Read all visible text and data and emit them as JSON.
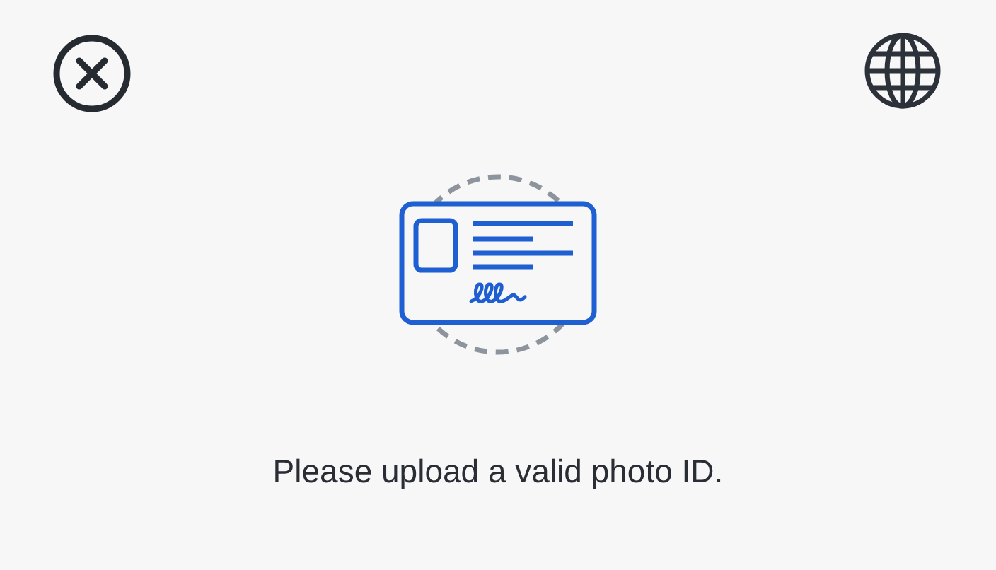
{
  "message": "Please upload a valid photo ID."
}
